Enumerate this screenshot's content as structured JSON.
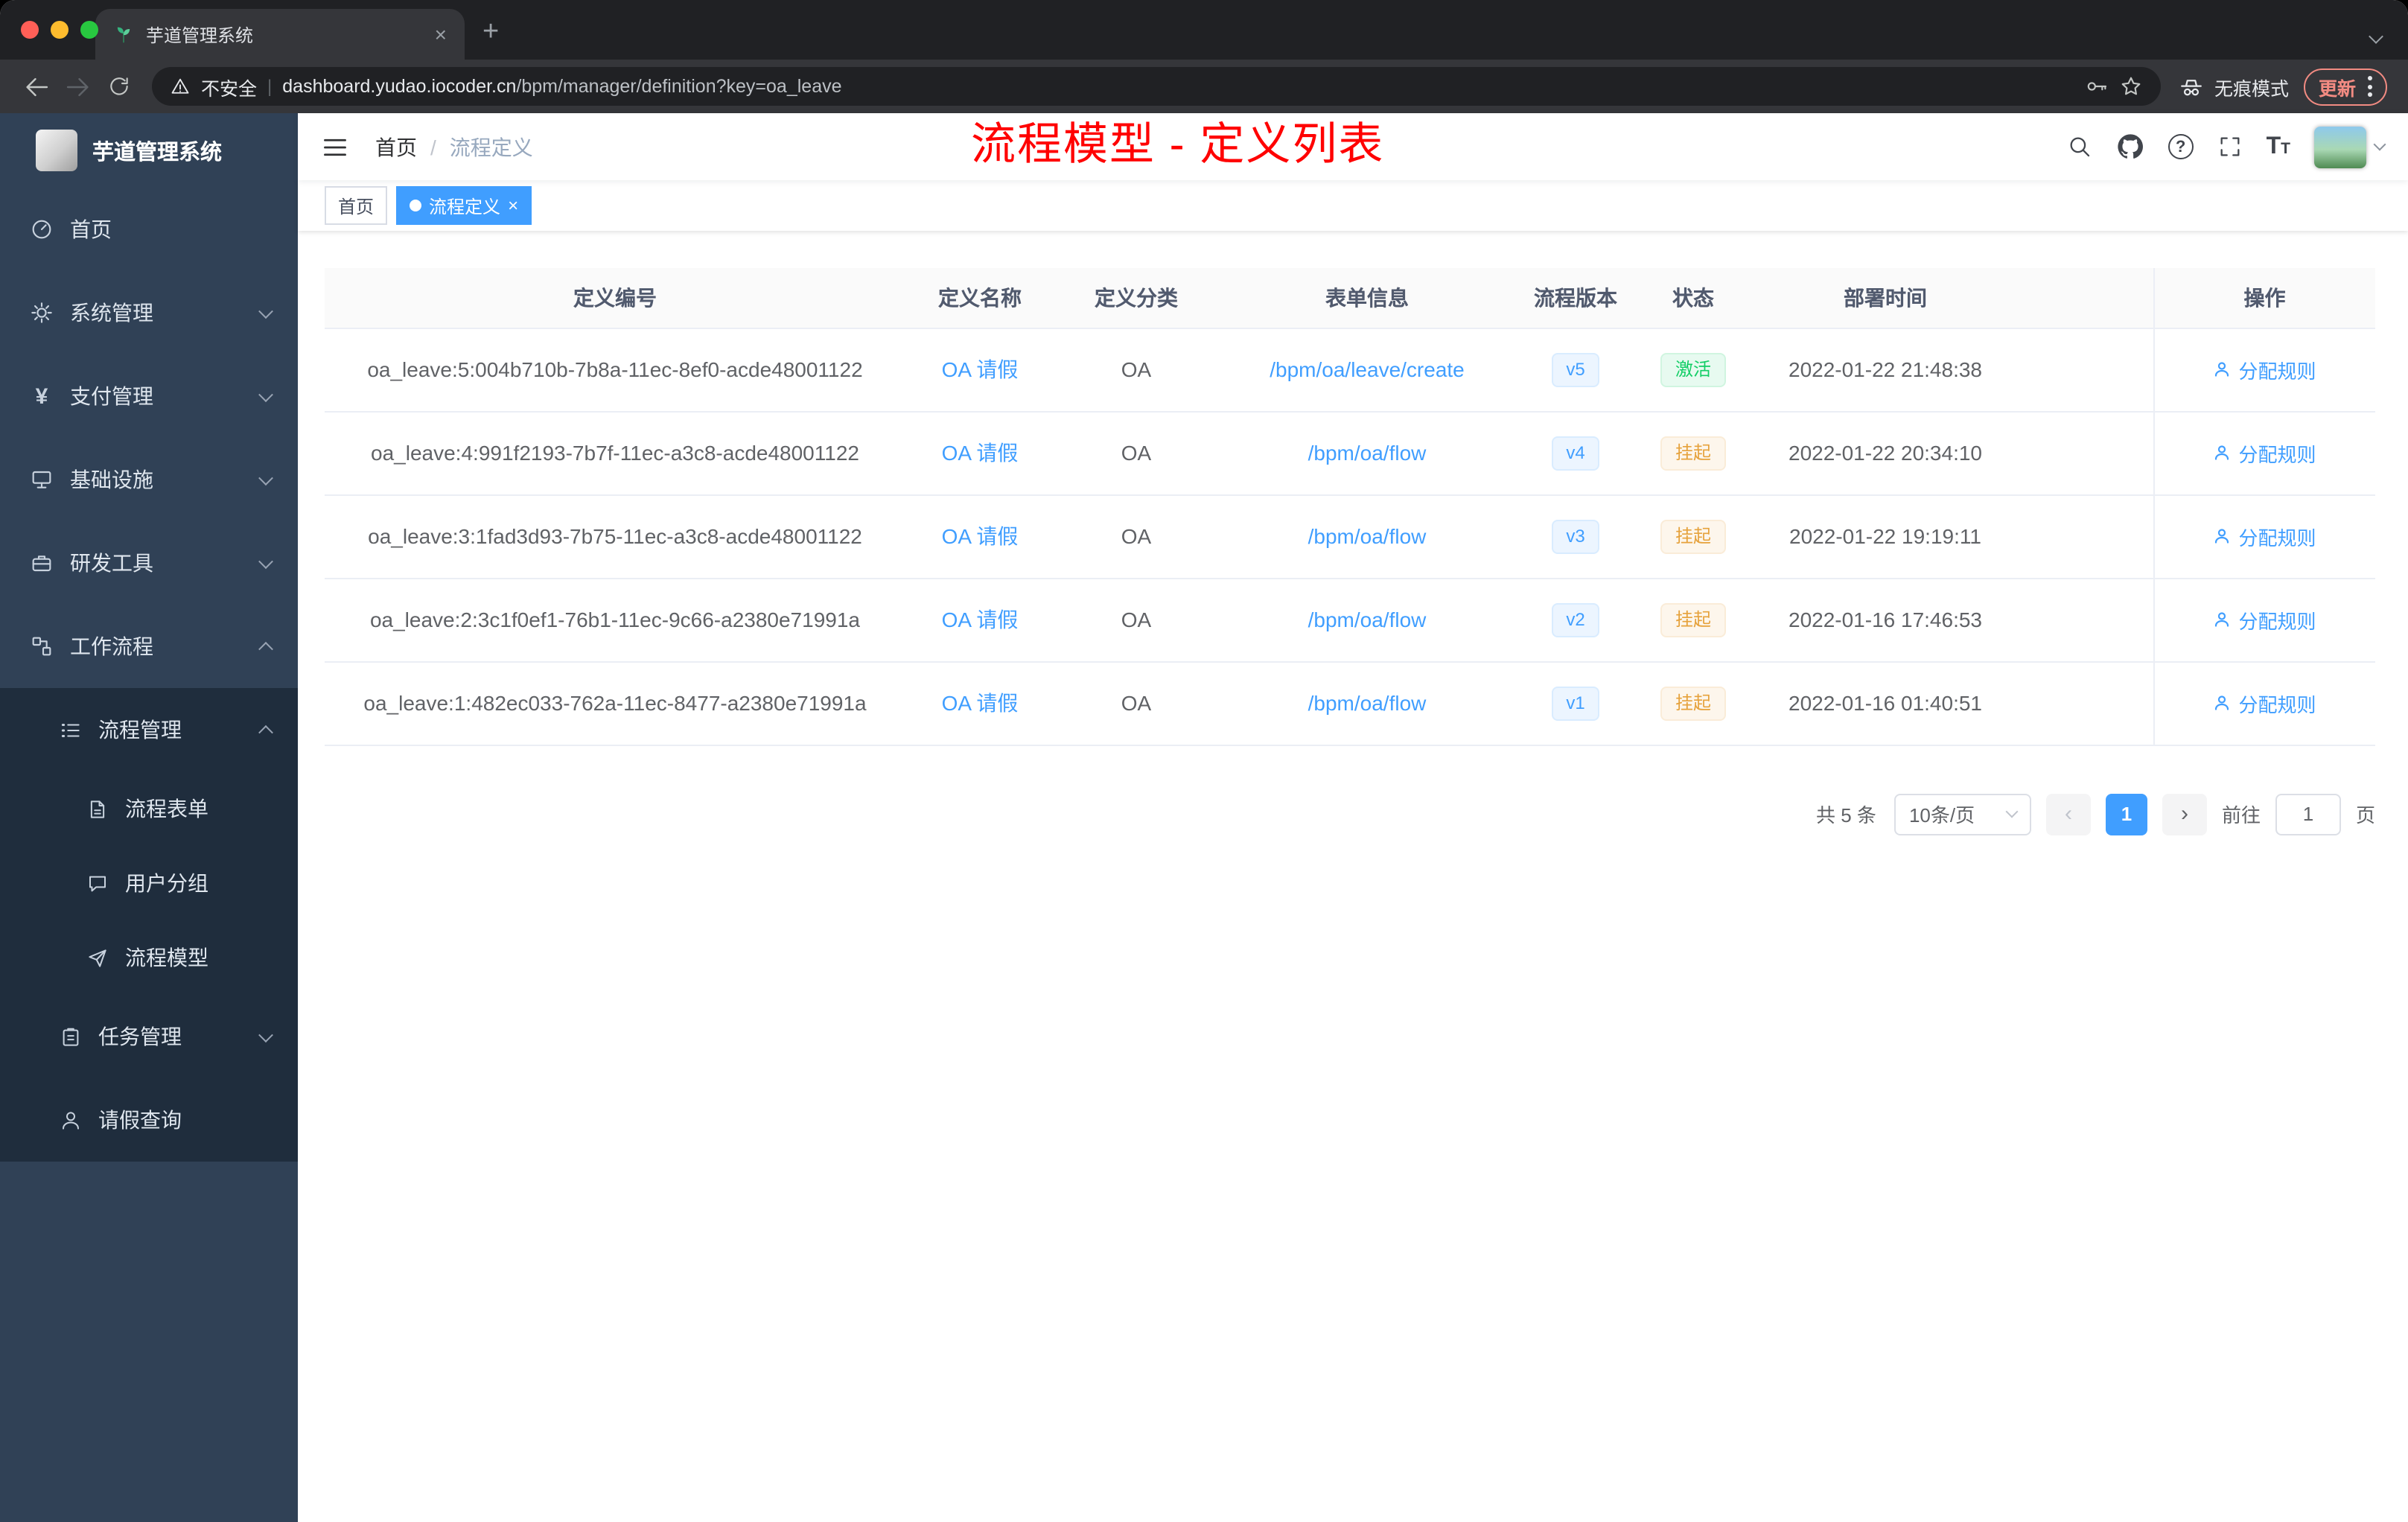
{
  "browser": {
    "tab_title": "芋道管理系统",
    "new_tab_glyph": "+",
    "close_glyph": "×",
    "address": {
      "warning": "不安全",
      "divider": "|",
      "domain": "dashboard.yudao.iocoder.cn",
      "path": "/bpm/manager/definition?key=oa_leave"
    },
    "incognito_label": "无痕模式",
    "update_label": "更新"
  },
  "sidebar": {
    "logo_title": "芋道管理系统",
    "items": [
      {
        "label": "首页"
      },
      {
        "label": "系统管理"
      },
      {
        "label": "支付管理"
      },
      {
        "label": "基础设施"
      },
      {
        "label": "研发工具"
      },
      {
        "label": "工作流程"
      },
      {
        "label": "流程管理"
      },
      {
        "label": "流程表单"
      },
      {
        "label": "用户分组"
      },
      {
        "label": "流程模型"
      },
      {
        "label": "任务管理"
      },
      {
        "label": "请假查询"
      }
    ]
  },
  "header": {
    "breadcrumb": {
      "home": "首页",
      "separator": "/",
      "current": "流程定义"
    },
    "annotation": "流程模型 - 定义列表",
    "help_glyph": "?",
    "font_icon_large": "T",
    "font_icon_small": "T"
  },
  "tags": {
    "home": "首页",
    "active": "流程定义",
    "close_glyph": "×"
  },
  "table": {
    "columns": [
      "定义编号",
      "定义名称",
      "定义分类",
      "表单信息",
      "流程版本",
      "状态",
      "部署时间",
      "操作"
    ],
    "rows": [
      {
        "id": "oa_leave:5:004b710b-7b8a-11ec-8ef0-acde48001122",
        "name": "OA 请假",
        "category": "OA",
        "form": "/bpm/oa/leave/create",
        "version": "v5",
        "status": "激活",
        "status_type": "success",
        "deploy_time": "2022-01-22 21:48:38",
        "action": "分配规则"
      },
      {
        "id": "oa_leave:4:991f2193-7b7f-11ec-a3c8-acde48001122",
        "name": "OA 请假",
        "category": "OA",
        "form": "/bpm/oa/flow",
        "version": "v4",
        "status": "挂起",
        "status_type": "warning",
        "deploy_time": "2022-01-22 20:34:10",
        "action": "分配规则"
      },
      {
        "id": "oa_leave:3:1fad3d93-7b75-11ec-a3c8-acde48001122",
        "name": "OA 请假",
        "category": "OA",
        "form": "/bpm/oa/flow",
        "version": "v3",
        "status": "挂起",
        "status_type": "warning",
        "deploy_time": "2022-01-22 19:19:11",
        "action": "分配规则"
      },
      {
        "id": "oa_leave:2:3c1f0ef1-76b1-11ec-9c66-a2380e71991a",
        "name": "OA 请假",
        "category": "OA",
        "form": "/bpm/oa/flow",
        "version": "v2",
        "status": "挂起",
        "status_type": "warning",
        "deploy_time": "2022-01-16 17:46:53",
        "action": "分配规则"
      },
      {
        "id": "oa_leave:1:482ec033-762a-11ec-8477-a2380e71991a",
        "name": "OA 请假",
        "category": "OA",
        "form": "/bpm/oa/flow",
        "version": "v1",
        "status": "挂起",
        "status_type": "warning",
        "deploy_time": "2022-01-16 01:40:51",
        "action": "分配规则"
      }
    ]
  },
  "pagination": {
    "total": "共 5 条",
    "page_size": "10条/页",
    "prev_glyph": "‹",
    "next_glyph": "›",
    "current_page": "1",
    "goto_label": "前往",
    "goto_value": "1",
    "unit_label": "页"
  },
  "colors": {
    "accent": "#409eff",
    "success": "#13ce66",
    "warning": "#e6a23c",
    "annotation": "#ff0000",
    "sidebar": "#304156",
    "sidebar_sub": "#1f2d3d"
  }
}
